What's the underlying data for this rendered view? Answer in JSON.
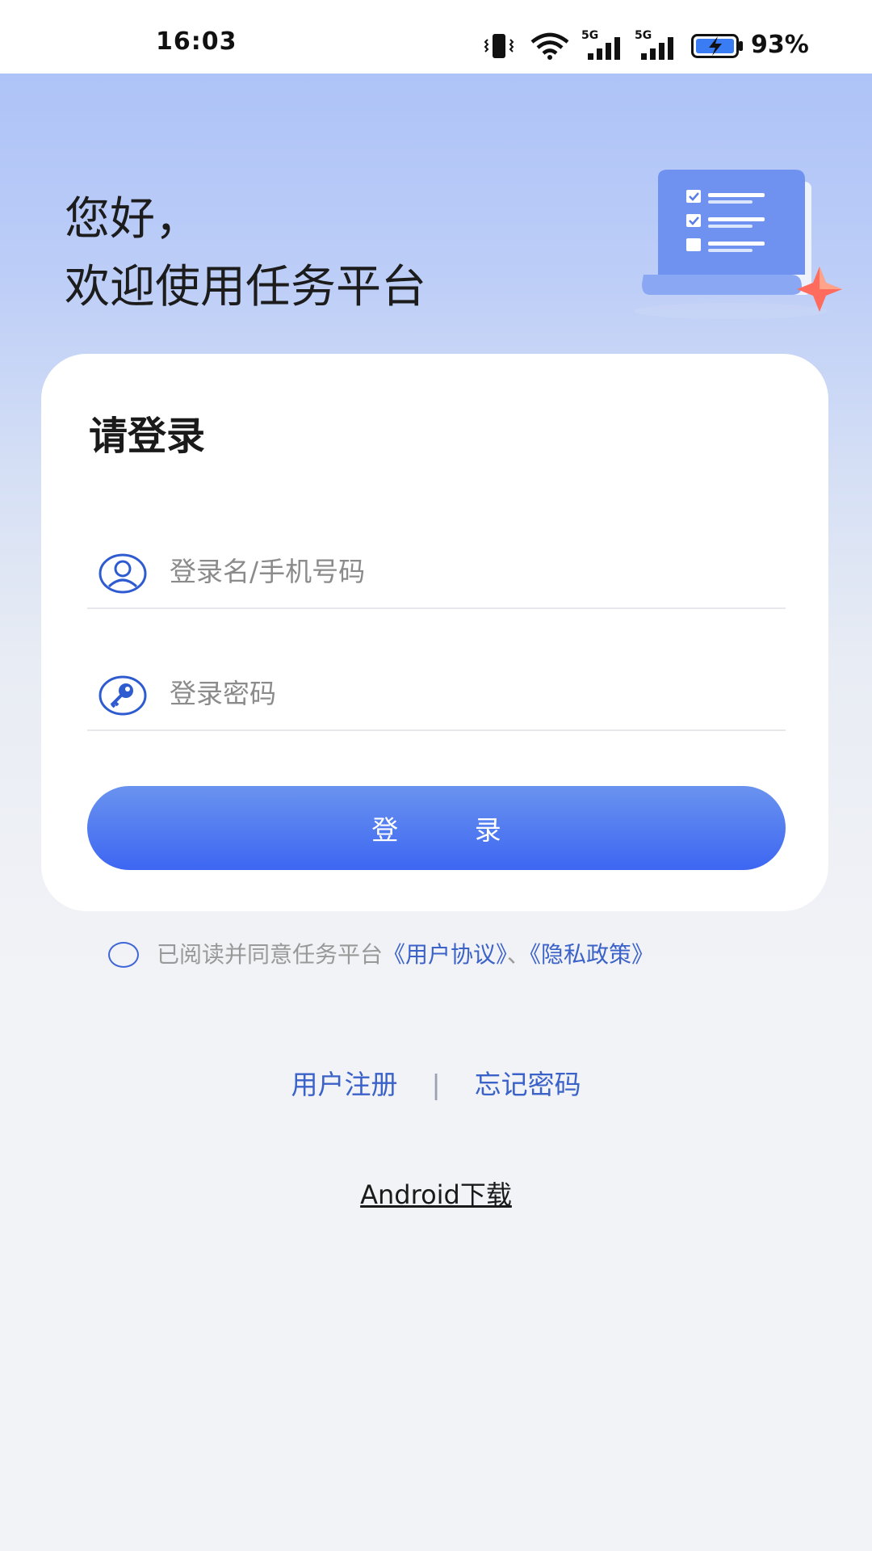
{
  "status_bar": {
    "time": "16:03",
    "battery_percent": "93%",
    "network_1": "5G",
    "network_2": "5G",
    "icons": [
      "vibrate-icon",
      "wifi-icon",
      "signal-5g-icon",
      "signal-5g-icon",
      "battery-charging-icon"
    ]
  },
  "hero": {
    "greeting_line1": "您好，",
    "greeting_line2": "欢迎使用任务平台",
    "illustration": "task-list-illustration"
  },
  "login_card": {
    "title": "请登录",
    "username": {
      "icon": "user-icon",
      "placeholder": "登录名/手机号码",
      "value": ""
    },
    "password": {
      "icon": "key-icon",
      "placeholder": "登录密码",
      "value": ""
    },
    "login_button_label": "登 录"
  },
  "agreement": {
    "checked": false,
    "prefix_text": "已阅读并同意任务平台",
    "user_agreement_link": "《用户协议》",
    "separator": "、",
    "privacy_policy_link": "《隐私政策》"
  },
  "footer_links": {
    "register": "用户注册",
    "divider": "|",
    "forgot_password": "忘记密码",
    "android_download": "Android下载"
  },
  "colors": {
    "accent": "#3d66f2",
    "link": "#3b62c9",
    "hero_top": "#aec3f7"
  }
}
